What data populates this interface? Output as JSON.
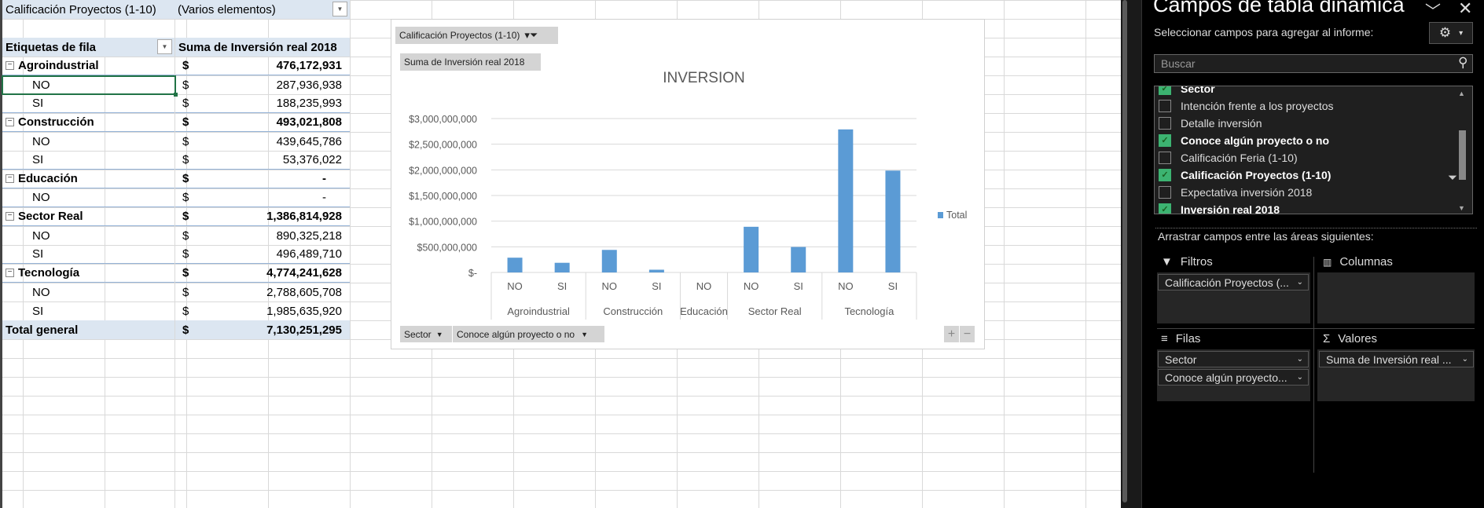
{
  "pivot": {
    "filter_label": "Calificación Proyectos (1-10)",
    "filter_value": "(Varios elementos)",
    "header_rows": "Etiquetas de fila",
    "header_values": "Suma de Inversión real 2018",
    "currency": "$",
    "rows": [
      {
        "label": "Agroindustrial",
        "value": "476,172,931",
        "level": 0
      },
      {
        "label": "NO",
        "value": "287,936,938",
        "level": 1
      },
      {
        "label": "SI",
        "value": "188,235,993",
        "level": 1
      },
      {
        "label": "Construcción",
        "value": "493,021,808",
        "level": 0
      },
      {
        "label": "NO",
        "value": "439,645,786",
        "level": 1
      },
      {
        "label": "SI",
        "value": "53,376,022",
        "level": 1
      },
      {
        "label": "Educación",
        "value": "-",
        "level": 0
      },
      {
        "label": "NO",
        "value": "-",
        "level": 1
      },
      {
        "label": "Sector Real",
        "value": "1,386,814,928",
        "level": 0
      },
      {
        "label": "NO",
        "value": "890,325,218",
        "level": 1
      },
      {
        "label": "SI",
        "value": "496,489,710",
        "level": 1
      },
      {
        "label": "Tecnología",
        "value": "4,774,241,628",
        "level": 0
      },
      {
        "label": "NO",
        "value": "2,788,605,708",
        "level": 1
      },
      {
        "label": "SI",
        "value": "1,985,635,920",
        "level": 1
      }
    ],
    "total_label": "Total general",
    "total_value": "7,130,251,295"
  },
  "chart_buttons": {
    "filter": "Calificación  Proyectos (1-10)",
    "values": "Suma de Inversión  real 2018",
    "axis1": "Sector",
    "axis2": "Conoce algún  proyecto  o no",
    "plus": "+",
    "minus": "−"
  },
  "chart_data": {
    "type": "bar",
    "title": "INVERSION",
    "groups": [
      "Agroindustrial",
      "Construcción",
      "Educación",
      "Sector Real",
      "Tecnología"
    ],
    "categories": [
      {
        "group": "Agroindustrial",
        "label": "NO"
      },
      {
        "group": "Agroindustrial",
        "label": "SI"
      },
      {
        "group": "Construcción",
        "label": "NO"
      },
      {
        "group": "Construcción",
        "label": "SI"
      },
      {
        "group": "Educación",
        "label": "NO"
      },
      {
        "group": "Sector Real",
        "label": "NO"
      },
      {
        "group": "Sector Real",
        "label": "SI"
      },
      {
        "group": "Tecnología",
        "label": "NO"
      },
      {
        "group": "Tecnología",
        "label": "SI"
      }
    ],
    "series": [
      {
        "name": "Total",
        "values": [
          287936938,
          188235993,
          439645786,
          53376022,
          0,
          890325218,
          496489710,
          2788605708,
          1985635920
        ]
      }
    ],
    "yticks": [
      0,
      500000000,
      1000000000,
      1500000000,
      2000000000,
      2500000000,
      3000000000
    ],
    "ytick_labels": [
      "$-",
      "$500,000,000",
      "$1,000,000,000",
      "$1,500,000,000",
      "$2,000,000,000",
      "$2,500,000,000",
      "$3,000,000,000"
    ],
    "ylim": [
      0,
      3000000000
    ],
    "legend": "right",
    "grid": true,
    "bar_color": "#5b9bd5"
  },
  "pane": {
    "title": "Campos de tabla dinámica",
    "subtitle": "Seleccionar campos para agregar al informe:",
    "search_placeholder": "Buscar",
    "fields": [
      {
        "label": "Sector",
        "checked": true
      },
      {
        "label": "Intención frente a los proyectos",
        "checked": false
      },
      {
        "label": "Detalle inversión",
        "checked": false
      },
      {
        "label": "Conoce algún proyecto o no",
        "checked": true
      },
      {
        "label": "Calificación Feria (1-10)",
        "checked": false
      },
      {
        "label": "Calificación Proyectos (1-10)",
        "checked": true
      },
      {
        "label": "Expectativa inversión 2018",
        "checked": false
      },
      {
        "label": "Inversión real 2018",
        "checked": true
      }
    ],
    "drag_label": "Arrastrar campos entre las áreas siguientes:",
    "areas": {
      "filters": {
        "label": "Filtros",
        "items": [
          "Calificación Proyectos (..."
        ]
      },
      "columns": {
        "label": "Columnas",
        "items": []
      },
      "rows": {
        "label": "Filas",
        "items": [
          "Sector",
          "Conoce algún proyecto..."
        ]
      },
      "values": {
        "label": "Valores",
        "items": [
          "Suma de Inversión real ..."
        ]
      }
    }
  }
}
